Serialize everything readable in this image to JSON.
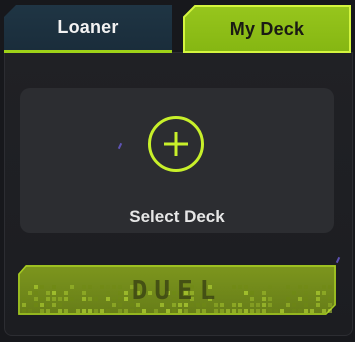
{
  "tabs": [
    {
      "label": "Loaner",
      "active": false
    },
    {
      "label": "My Deck",
      "active": true
    }
  ],
  "deck_slot": {
    "label": "Select Deck"
  },
  "duel_button": {
    "label": "DUEL",
    "enabled": false
  },
  "colors": {
    "accent": "#9fd218",
    "tab_inactive": "#1f3544",
    "card_bg": "#2c2d31",
    "panel_bg": "#1e1f23"
  },
  "icons": {
    "add": "plus-circle-icon"
  }
}
